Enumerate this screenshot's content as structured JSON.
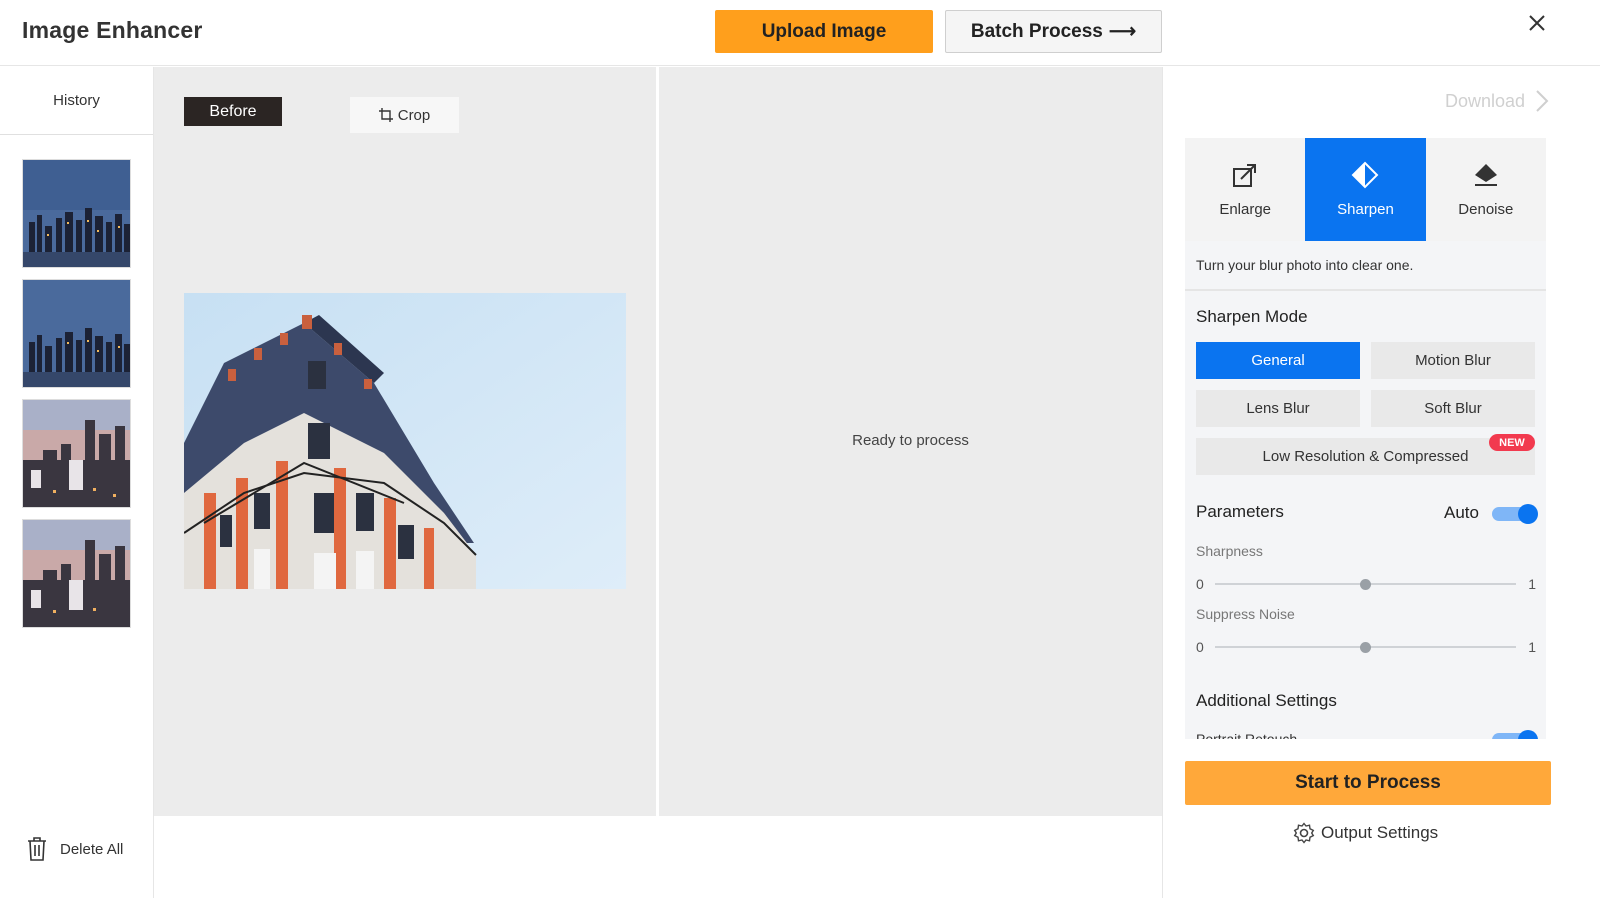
{
  "header": {
    "title": "Image Enhancer",
    "upload_label": "Upload Image",
    "batch_label": "Batch Process",
    "batch_arrow": "⟶"
  },
  "sidebar": {
    "history_label": "History",
    "delete_all_label": "Delete All"
  },
  "canvas": {
    "before_label": "Before",
    "crop_label": "Crop",
    "ready_text": "Ready to process"
  },
  "panel": {
    "download_label": "Download",
    "tabs": [
      {
        "label": "Enlarge",
        "icon": "enlarge-icon",
        "active": false
      },
      {
        "label": "Sharpen",
        "icon": "sharpen-icon",
        "active": true
      },
      {
        "label": "Denoise",
        "icon": "denoise-icon",
        "active": false
      }
    ],
    "tagline": "Turn your blur photo into clear one.",
    "sharpen_mode_title": "Sharpen Mode",
    "modes": {
      "general": "General",
      "motion_blur": "Motion Blur",
      "lens_blur": "Lens Blur",
      "soft_blur": "Soft Blur",
      "low_res": "Low Resolution & Compressed",
      "selected": "General"
    },
    "new_badge": "NEW",
    "parameters_title": "Parameters",
    "auto_label": "Auto",
    "auto_enabled": true,
    "sharpness": {
      "label": "Sharpness",
      "min": "0",
      "max": "1",
      "value": 0.5
    },
    "suppress_noise": {
      "label": "Suppress Noise",
      "min": "0",
      "max": "1",
      "value": 0.5
    },
    "additional_title": "Additional Settings",
    "portrait_retouch_label": "Portrait Retouch",
    "portrait_retouch_enabled": true,
    "start_label": "Start to Process",
    "output_settings_label": "Output Settings"
  },
  "colors": {
    "accent_blue": "#0a74f0",
    "upload_orange": "#ff9f1c",
    "start_orange": "#ffa83a",
    "new_badge_red": "#f23a4f"
  }
}
